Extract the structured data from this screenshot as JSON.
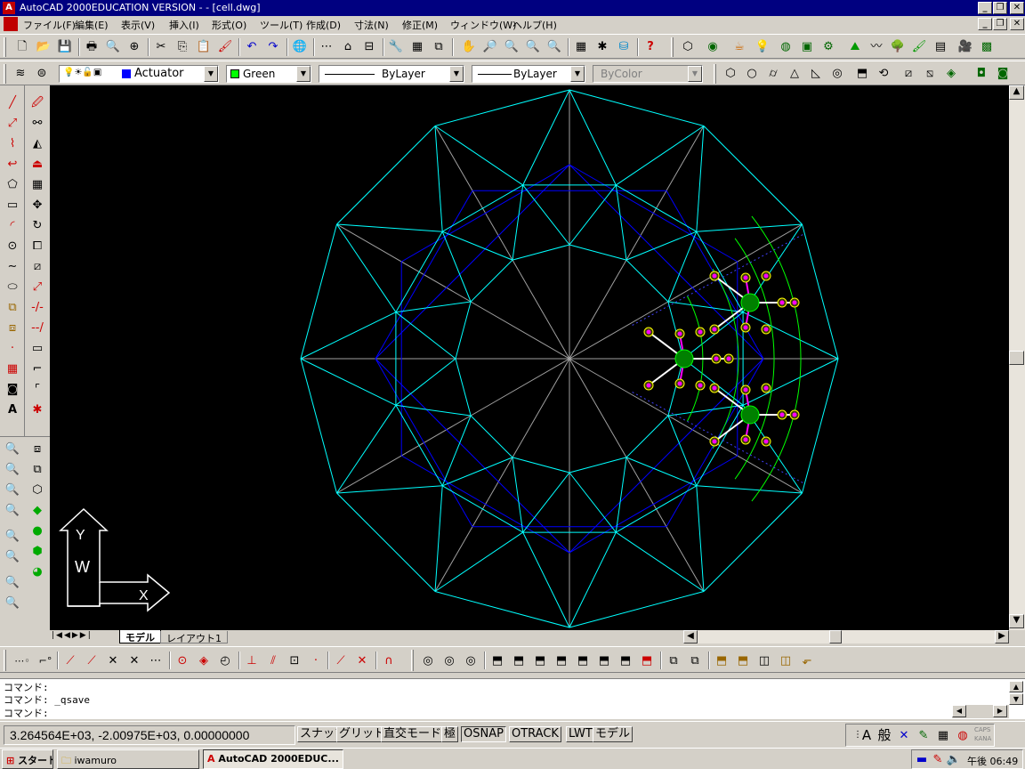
{
  "window": {
    "title": "AutoCAD 2000EDUCATION VERSION -  - [cell.dwg]"
  },
  "menu": [
    "ファイル(F)",
    "編集(E)",
    "表示(V)",
    "挿入(I)",
    "形式(O)",
    "ツール(T)",
    "作成(D)",
    "寸法(N)",
    "修正(M)",
    "ウィンドウ(W)",
    "ヘルプ(H)"
  ],
  "properties": {
    "layer": "Actuator",
    "color": "Green",
    "color_hex": "#00ff00",
    "linetype": "ByLayer",
    "lineweight": "ByLayer",
    "plotstyle": "ByColor"
  },
  "ucs": {
    "y_label": "Y",
    "x_label": "X",
    "w_label": "W"
  },
  "tabs": [
    "モデル",
    "レイアウト1"
  ],
  "command": {
    "lines": [
      "コマンド:",
      "コマンド: _qsave",
      "コマンド:"
    ]
  },
  "status": {
    "coords": "3.264564E+03, -2.00975E+03, 0.00000000",
    "buttons": [
      "スナップ",
      "グリッド",
      "直交モード",
      "極",
      "OSNAP",
      "OTRACK",
      "LWT",
      "モデル"
    ],
    "ime": [
      "A",
      "般"
    ],
    "caps": "CAPS",
    "kana": "KANA"
  },
  "taskbar": {
    "start": "スタート",
    "items": [
      "iwamuro",
      "AutoCAD 2000EDUC..."
    ],
    "clock": "午後 06:49"
  },
  "colors": {
    "cyan": "#00ffff",
    "blue": "#0000ff",
    "gray": "#a0a0a0",
    "green": "#00ff00",
    "magenta": "#ff00ff",
    "yellow": "#ffff00"
  }
}
